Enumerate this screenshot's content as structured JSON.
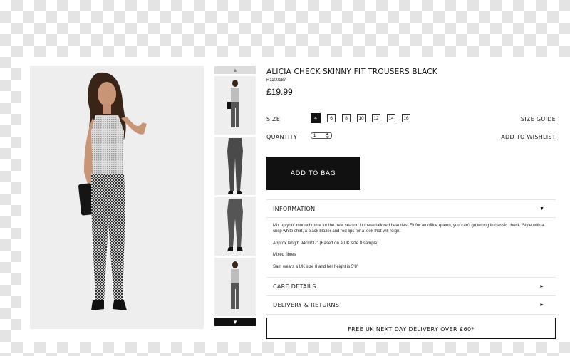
{
  "product": {
    "title": "ALICIA CHECK SKINNY FIT TROUSERS BLACK",
    "sku": "R1100187",
    "price": "£19.99"
  },
  "gallery": {
    "up_arrow": "▲",
    "down_arrow": "▼"
  },
  "size": {
    "label": "SIZE",
    "options": [
      "4",
      "6",
      "8",
      "10",
      "12",
      "14",
      "16"
    ],
    "selected": "4",
    "guide_link": "SIZE GUIDE"
  },
  "quantity": {
    "label": "QUANTITY",
    "value": "1",
    "wishlist_link": "ADD TO WISHLIST"
  },
  "add_to_bag": "ADD TO BAG",
  "accordion": {
    "information": {
      "label": "INFORMATION",
      "arrow": "▼",
      "paragraphs": [
        "Mix up your monochrome for the new season in these tailored beauties. Fit for an office queen, you can't go wrong in classic check. Style with a crisp white shirt, a black blazer and red lips for a look that will reign.",
        "Approx length 94cm/37\" (Based on a UK size 8 sample)",
        "Mixed fibres",
        "Sam wears a UK size 8 and her height is 5'8\""
      ]
    },
    "care": {
      "label": "CARE DETAILS",
      "arrow": "►"
    },
    "delivery": {
      "label": "DELIVERY & RETURNS",
      "arrow": "►"
    }
  },
  "delivery_banner": "FREE UK NEXT DAY DELIVERY OVER £60*",
  "colors": {
    "accent": "#111111",
    "checker": "#e4e4e4",
    "image_bg": "#eeeeee"
  }
}
